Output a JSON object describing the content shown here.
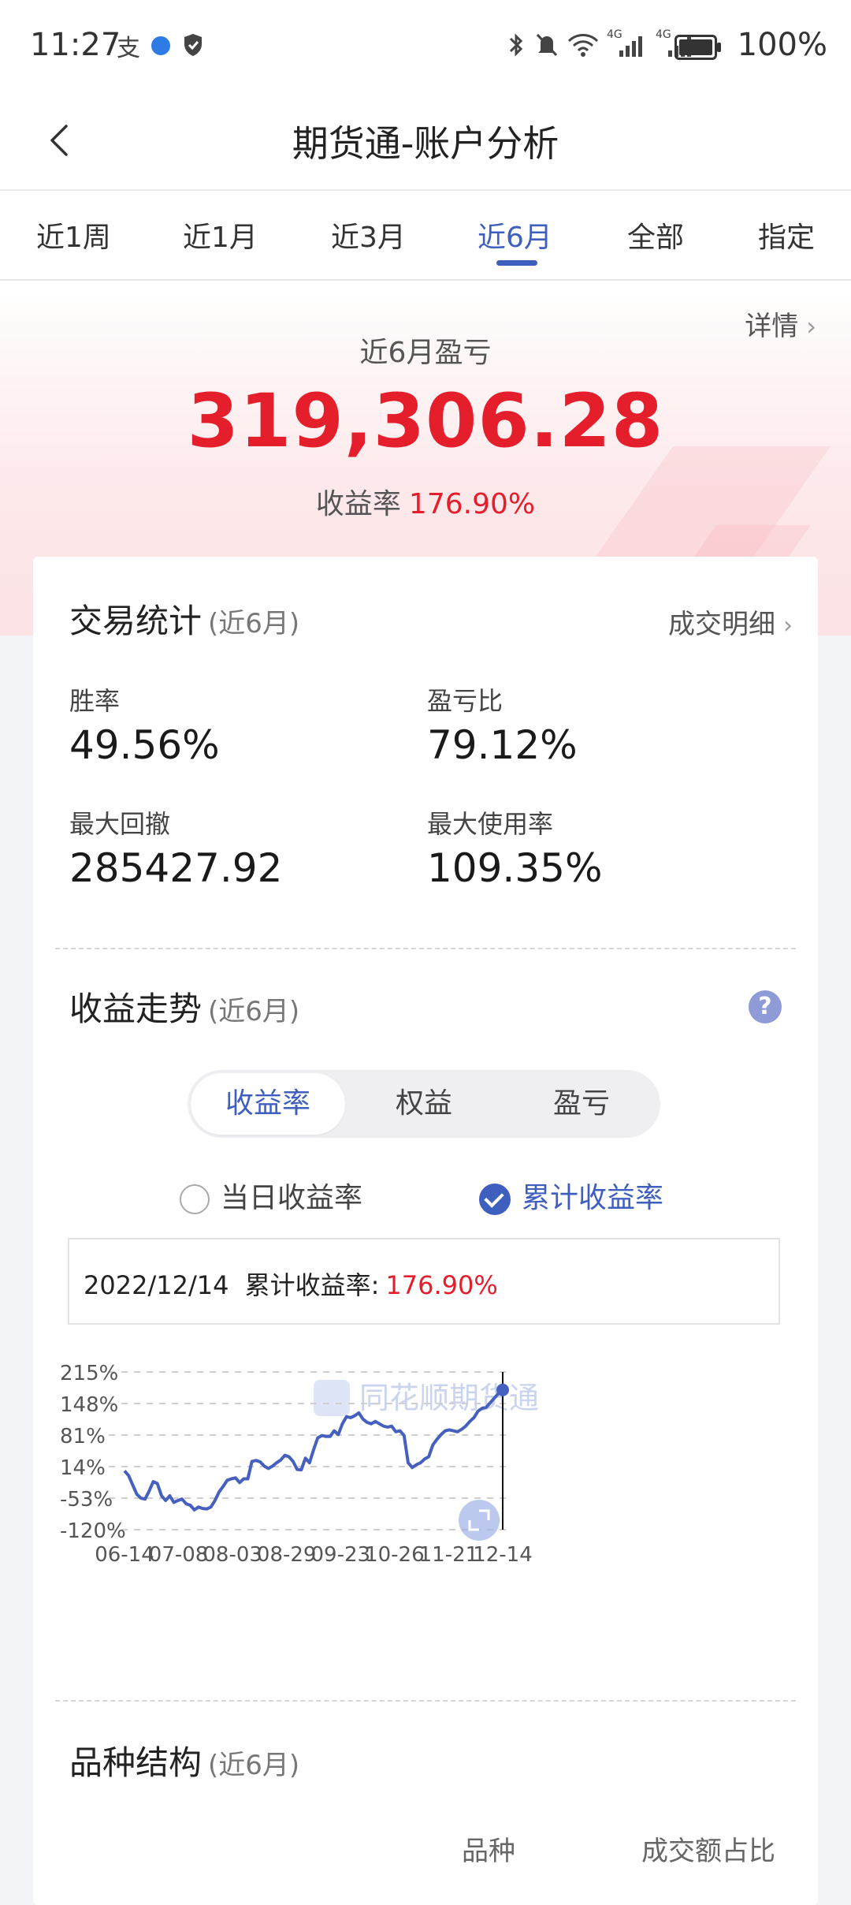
{
  "status_bar": {
    "time": "11:27",
    "battery": "100%",
    "network_labels": [
      "4G",
      "4G"
    ]
  },
  "header": {
    "title": "期货通-账户分析"
  },
  "tabs": [
    {
      "label": "近1周",
      "active": false
    },
    {
      "label": "近1月",
      "active": false
    },
    {
      "label": "近3月",
      "active": false
    },
    {
      "label": "近6月",
      "active": true
    },
    {
      "label": "全部",
      "active": false
    },
    {
      "label": "指定",
      "active": false
    }
  ],
  "summary": {
    "detail_link": "详情",
    "pl_label": "近6月盈亏",
    "pl_value": "319,306.28",
    "return_label": "收益率",
    "return_value": "176.90%"
  },
  "trade_stats": {
    "title": "交易统计",
    "period": "(近6月)",
    "link": "成交明细",
    "items": [
      {
        "label": "胜率",
        "value": "49.56%"
      },
      {
        "label": "盈亏比",
        "value": "79.12%"
      },
      {
        "label": "最大回撤",
        "value": "285427.92"
      },
      {
        "label": "最大使用率",
        "value": "109.35%"
      }
    ]
  },
  "trend": {
    "title": "收益走势",
    "period": "(近6月)",
    "help_icon": "?",
    "segments": [
      "收益率",
      "权益",
      "盈亏"
    ],
    "radio_daily": "当日收益率",
    "radio_cumulative": "累计收益率",
    "info_date": "2022/12/14",
    "info_label": "累计收益率:",
    "info_value": "176.90%",
    "watermark": "同花顺期货通"
  },
  "chart_data": {
    "type": "line",
    "title": "",
    "xlabel": "",
    "ylabel": "",
    "ytick_labels": [
      "215%",
      "148%",
      "81%",
      "14%",
      "-53%",
      "-120%"
    ],
    "yticks": [
      215,
      148,
      81,
      14,
      -53,
      -120
    ],
    "xtick_labels": [
      "06-14",
      "07-08",
      "08-03",
      "08-29",
      "09-23",
      "10-26",
      "11-21",
      "12-14"
    ],
    "ylim": [
      -120,
      215
    ],
    "grid": true,
    "line_color": "#4560be",
    "series": [
      {
        "values": [
          5,
          -5,
          -25,
          -45,
          -53,
          -55,
          -38,
          -18,
          -22,
          -48,
          -58,
          -48,
          -62,
          -58,
          -55,
          -65,
          -68,
          -78,
          -72,
          -75,
          -76,
          -72,
          -58,
          -40,
          -28,
          -15,
          -12,
          -10,
          -20,
          -12,
          -12,
          25,
          27,
          24,
          15,
          10,
          15,
          22,
          28,
          38,
          35,
          25,
          8,
          7,
          32,
          22,
          50,
          75,
          80,
          78,
          78,
          90,
          82,
          105,
          120,
          118,
          122,
          128,
          115,
          108,
          105,
          110,
          105,
          100,
          98,
          100,
          88,
          90,
          80,
          22,
          12,
          18,
          22,
          30,
          35,
          60,
          72,
          82,
          90,
          92,
          90,
          88,
          93,
          100,
          110,
          118,
          132,
          138,
          140,
          150,
          160,
          170,
          176.9
        ]
      }
    ]
  },
  "variety": {
    "title": "品种结构",
    "period": "(近6月)",
    "col_variety": "品种",
    "col_share": "成交额占比"
  }
}
